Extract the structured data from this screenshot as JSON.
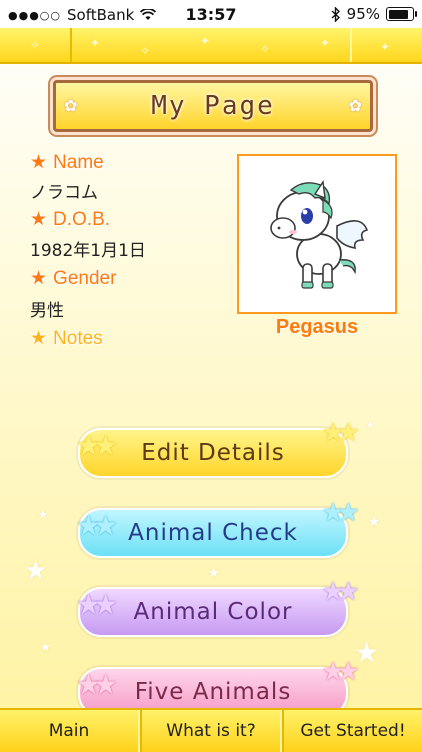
{
  "status_bar": {
    "signal": "●●●○○",
    "carrier": "SoftBank",
    "time": "13:57",
    "battery_percent": "95%",
    "battery_level": 0.95
  },
  "header": {
    "title": "My Page"
  },
  "profile": {
    "fields": [
      {
        "label": "Name",
        "value": "ノラコム"
      },
      {
        "label": "D.O.B.",
        "value": "1982年1月1日"
      },
      {
        "label": "Gender",
        "value": "男性"
      },
      {
        "label": "Notes",
        "value": ""
      }
    ],
    "star_glyph": "★",
    "animal_name": "Pegasus",
    "animal_icon": "pegasus-illustration"
  },
  "buttons": {
    "edit_details": "Edit Details",
    "animal_check": "Animal Check",
    "animal_color": "Animal Color",
    "five_animals": "Five Animals"
  },
  "tabs": {
    "main": "Main",
    "what_is_it": "What is it?",
    "get_started": "Get Started!"
  },
  "colors": {
    "accent_orange": "#ff7a10",
    "nav_yellow": "#ffd61c",
    "button_yellow": "#ffd52a",
    "button_blue": "#6ee0f5",
    "button_purple": "#c69af2",
    "button_pink": "#f59ac6"
  }
}
